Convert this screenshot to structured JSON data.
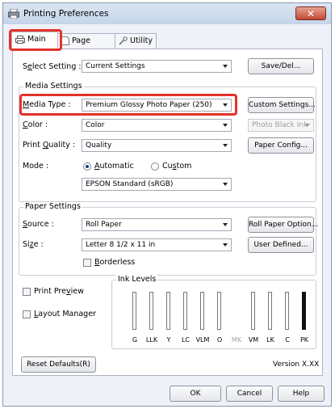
{
  "window": {
    "title": "Printing Preferences",
    "close_glyph": "✕"
  },
  "tabs": [
    {
      "label": "Main",
      "icon": "printer-icon"
    },
    {
      "label": "Page Layout",
      "icon": "page-icon"
    },
    {
      "label": "Utility",
      "icon": "wrench-icon"
    }
  ],
  "select_setting": {
    "label_pre": "S",
    "label_u": "e",
    "label_post": "lect Setting :",
    "value": "Current Settings",
    "button": "Save/Del..."
  },
  "media_settings": {
    "title": "Media Settings",
    "media_type": {
      "label_u": "M",
      "label_post": "edia Type :",
      "value": "Premium Glossy Photo Paper (250)",
      "button": "Custom Settings..."
    },
    "color": {
      "label_u": "C",
      "label_post": "olor :",
      "value": "Color",
      "ink_value": "Photo Black Ink"
    },
    "print_quality": {
      "label_pre": "Print ",
      "label_u": "Q",
      "label_post": "uality :",
      "value": "Quality",
      "button": "Paper Config..."
    },
    "mode": {
      "label": "Mode :",
      "automatic_u": "A",
      "automatic_post": "utomatic",
      "custom_pre": "Cu",
      "custom_u": "s",
      "custom_post": "tom",
      "value": "EPSON Standard (sRGB)"
    }
  },
  "paper_settings": {
    "title": "Paper Settings",
    "source": {
      "label_u": "S",
      "label_post": "ource :",
      "value": "Roll Paper",
      "button": "Roll Paper Option..."
    },
    "size": {
      "label_pre": "Si",
      "label_u": "z",
      "label_post": "e :",
      "value": "Letter 8 1/2 x 11 in",
      "button": "User Defined..."
    },
    "borderless_u": "B",
    "borderless_post": "orderless"
  },
  "print_preview": {
    "label_pre": "Print Pre",
    "label_u": "v",
    "label_post": "iew"
  },
  "layout_manager": {
    "label_u": "L",
    "label_post": "ayout Manager"
  },
  "ink_levels": {
    "title": "Ink Levels",
    "inks": [
      {
        "code": "G",
        "dim": false
      },
      {
        "code": "LLK",
        "dim": false
      },
      {
        "code": "Y",
        "dim": false
      },
      {
        "code": "LC",
        "dim": false
      },
      {
        "code": "VLM",
        "dim": false
      },
      {
        "code": "O",
        "dim": false
      },
      {
        "code": "MK",
        "dim": true
      },
      {
        "code": "VM",
        "dim": false
      },
      {
        "code": "LK",
        "dim": false
      },
      {
        "code": "C",
        "dim": false
      },
      {
        "code": "PK",
        "dim": false
      }
    ]
  },
  "reset_defaults": "Reset Defaults(R)",
  "version": "Version X.XX",
  "footer": {
    "ok": "OK",
    "cancel": "Cancel",
    "help": "Help"
  }
}
